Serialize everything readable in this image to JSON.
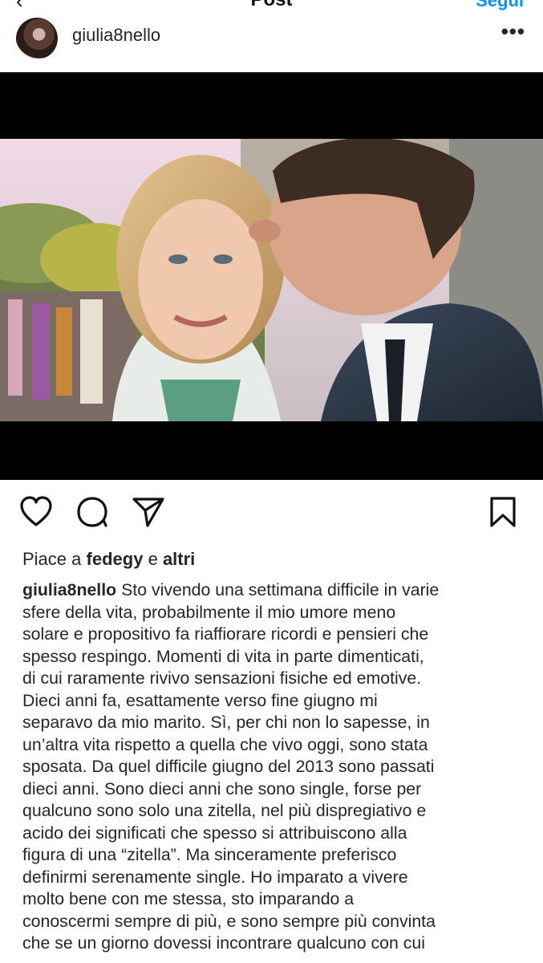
{
  "header": {
    "back_icon": "chevron-left-icon",
    "title": "Post",
    "right_action": "Segui"
  },
  "post": {
    "username": "giulia8nello",
    "more_icon": "more-horizontal-icon"
  },
  "actions": {
    "like_icon": "heart-icon",
    "comment_icon": "comment-icon",
    "share_icon": "send-icon",
    "save_icon": "bookmark-icon"
  },
  "likes": {
    "prefix": "Piace a",
    "user": "fedegy",
    "joiner": "e",
    "others": "altri"
  },
  "caption": {
    "username": "giulia8nello",
    "lines": [
      " Sto vivendo una settimana difficile in varie",
      "sfere della vita, probabilmente il mio umore meno",
      "solare e propositivo fa riaffiorare ricordi e pensieri che",
      "spesso respingo. Momenti di vita in parte dimenticati,",
      "di cui raramente rivivo sensazioni fisiche ed emotive.",
      "Dieci anni fa, esattamente verso fine giugno mi",
      "separavo da mio marito. Sì, per chi non lo sapesse, in",
      "un’altra vita rispetto a quella che vivo oggi, sono stata",
      "sposata. Da quel difficile giugno del 2013 sono passati",
      "dieci anni. Sono dieci anni che sono single, forse per",
      "qualcuno sono solo una zitella, nel più dispregiativo e",
      "acido dei significati che spesso si attribuiscono alla",
      "figura di una “zitella”. Ma sinceramente preferisco",
      "definirmi serenamente single. Ho imparato a vivere",
      "molto bene con me stessa, sto imparando a",
      "conoscermi sempre di più, e sono sempre più convinta",
      "che se un giorno dovessi incontrare qualcuno con cui"
    ]
  },
  "colors": {
    "text": "#262626",
    "media_background": "#000000",
    "link_blue": "#0095f6"
  }
}
